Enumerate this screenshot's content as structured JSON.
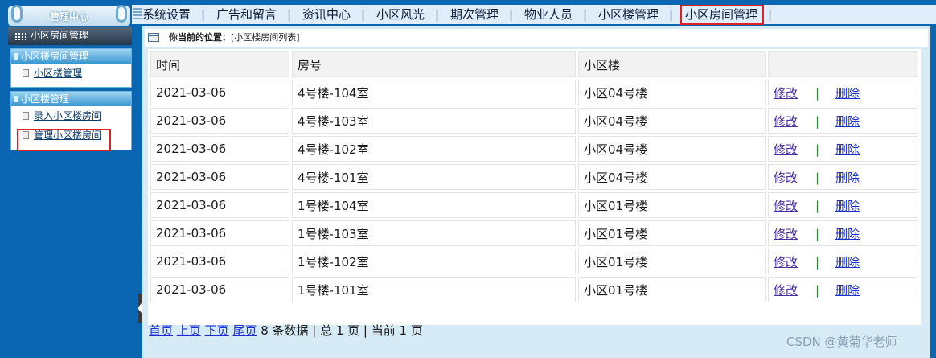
{
  "sidebar": {
    "header": "管理中心",
    "title": "小区房间管理",
    "groups": [
      {
        "label": "小区楼房间管理",
        "items": [
          "小区楼管理"
        ]
      },
      {
        "label": "小区楼管理",
        "items": [
          "录入小区楼房间",
          "管理小区楼房间"
        ]
      }
    ]
  },
  "topnav": {
    "items": [
      "系统设置",
      "广告和留言",
      "资讯中心",
      "小区风光",
      "期次管理",
      "物业人员",
      "小区楼管理",
      "小区房间管理"
    ],
    "separator": "|"
  },
  "breadcrumb": {
    "prefix": "你当前的位置：",
    "path": "[小区楼房间列表]"
  },
  "table": {
    "headers": [
      "时间",
      "房号",
      "小区楼",
      ""
    ],
    "rows": [
      {
        "date": "2021-03-06",
        "room": "4号楼-104室",
        "building": "小区04号楼"
      },
      {
        "date": "2021-03-06",
        "room": "4号楼-103室",
        "building": "小区04号楼"
      },
      {
        "date": "2021-03-06",
        "room": "4号楼-102室",
        "building": "小区04号楼"
      },
      {
        "date": "2021-03-06",
        "room": "4号楼-101室",
        "building": "小区04号楼"
      },
      {
        "date": "2021-03-06",
        "room": "1号楼-104室",
        "building": "小区01号楼"
      },
      {
        "date": "2021-03-06",
        "room": "1号楼-103室",
        "building": "小区01号楼"
      },
      {
        "date": "2021-03-06",
        "room": "1号楼-102室",
        "building": "小区01号楼"
      },
      {
        "date": "2021-03-06",
        "room": "1号楼-101室",
        "building": "小区01号楼"
      }
    ],
    "edit_label": "修改",
    "delete_label": "删除",
    "action_separator": "|"
  },
  "pager": {
    "first": "首页",
    "prev": "上页",
    "next": "下页",
    "last": "尾页",
    "summary": "8 条数据 | 总 1 页 | 当前 1 页"
  },
  "watermark": "CSDN @黄菊华老师"
}
